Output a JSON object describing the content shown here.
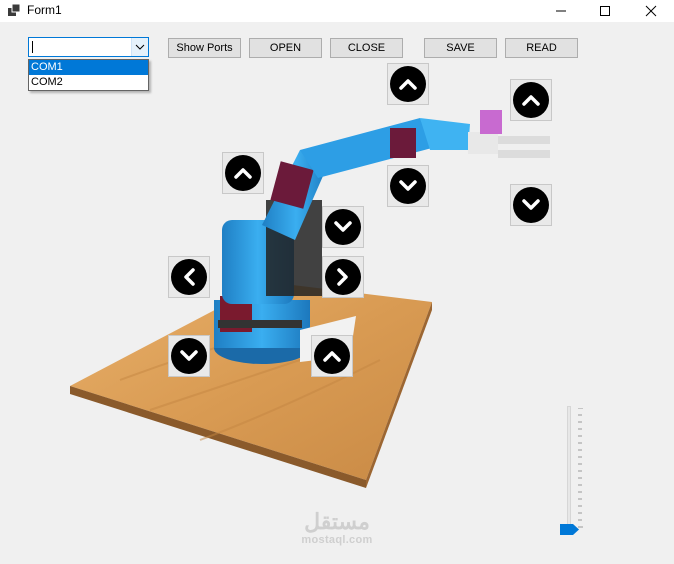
{
  "window": {
    "title": "Form1",
    "minimize_glyph": "—",
    "maximize_glyph": "☐",
    "close_glyph": "✕"
  },
  "port_combo": {
    "value": "",
    "options": [
      "COM1",
      "COM2"
    ],
    "highlighted": "COM1"
  },
  "toolbar": {
    "show_ports": "Show Ports",
    "open": "OPEN",
    "close": "CLOSE",
    "save": "SAVE",
    "read": "READ"
  },
  "controls": {
    "arrow_icons": [
      "chevron-up-icon",
      "chevron-down-icon",
      "chevron-left-icon",
      "chevron-right-icon"
    ]
  },
  "slider": {
    "value_fraction": 0.0
  },
  "watermark": {
    "arabic": "مستقل",
    "url": "mostaql.com"
  },
  "colors": {
    "accent": "#0078d7",
    "robot_blue": "#2a9ee6",
    "wood": "#d9a25c"
  }
}
